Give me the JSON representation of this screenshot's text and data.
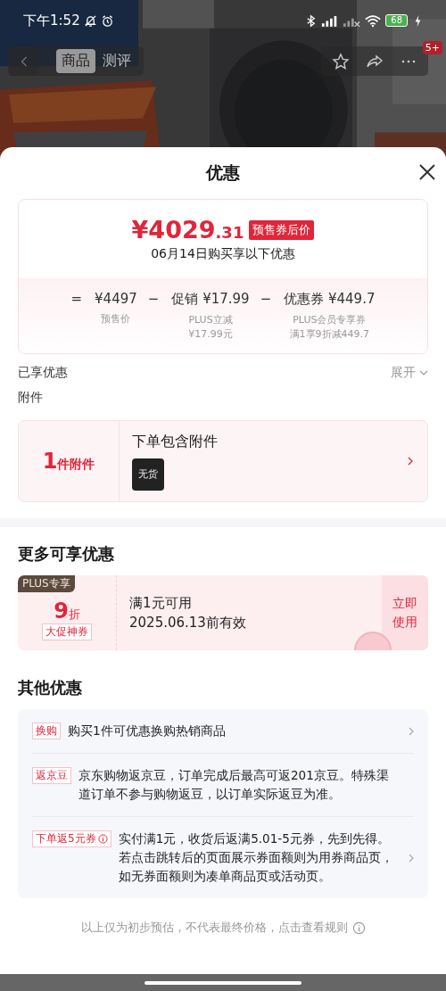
{
  "status_bar": {
    "time": "下午1:52",
    "battery": "68"
  },
  "nav": {
    "tabs": [
      {
        "label": "商品",
        "selected": true
      },
      {
        "label": "测评",
        "selected": false
      }
    ],
    "badge": "5+"
  },
  "sheet": {
    "title": "优惠"
  },
  "price_card": {
    "price_main": "¥4029",
    "price_decimal": ".31",
    "tag": "预售券后价",
    "subtitle": "06月14日购买享以下优惠",
    "terms": [
      {
        "op": "=",
        "amount": "¥4497",
        "label": "预售价"
      },
      {
        "op": "−",
        "amount": "促销 ¥17.99",
        "label": "PLUS立减",
        "note": "¥17.99元"
      },
      {
        "op": "−",
        "amount": "优惠券 ¥449.7",
        "label": "PLUS会员专享券",
        "note": "满1享9折减449.7"
      }
    ]
  },
  "enjoyed": {
    "title": "已享优惠",
    "toggle": "展开"
  },
  "accessories": {
    "title": "附件",
    "count": "1",
    "count_unit": "件附件",
    "heading": "下单包含附件",
    "item_status": "无货"
  },
  "more": {
    "title": "更多可享优惠",
    "coupon": {
      "badge": "PLUS专享",
      "value": "9",
      "unit": "折",
      "tag": "大促神券",
      "condition": "满1元可用",
      "validity": "2025.06.13前有效",
      "action": "立即使用"
    }
  },
  "others": {
    "title": "其他优惠",
    "items": [
      {
        "tag": "换购",
        "info": false,
        "text": "购买1件可优惠换购热销商品",
        "has_arrow": true
      },
      {
        "tag": "返京豆",
        "info": false,
        "text": "京东购物返京豆，订单完成后最高可返201京豆。特殊渠道订单不参与购物返豆，以订单实际返豆为准。",
        "has_arrow": false
      },
      {
        "tag": "下单返5元券",
        "info": true,
        "text": "实付满1元，收货后返满5.01-5元券，先到先得。若点击跳转后的页面展示券面额则为用券商品页，如无券面额则为凑单商品页或活动页。",
        "has_arrow": true
      }
    ]
  },
  "footer": "以上仅为初步预估，不代表最终价格，点击查看规则"
}
